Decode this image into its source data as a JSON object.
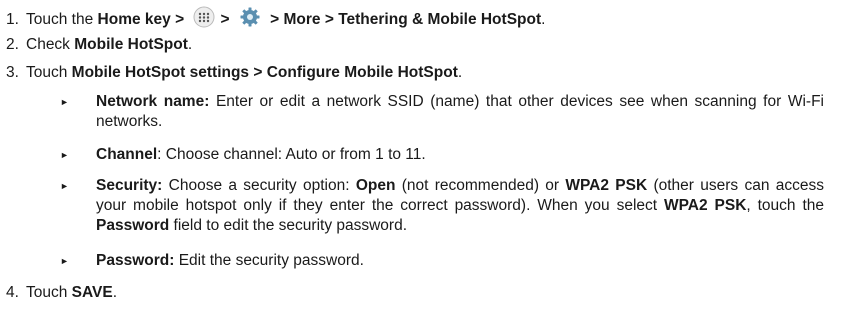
{
  "icons": {
    "apps": "apps-grid-icon",
    "settings": "settings-gear-icon"
  },
  "steps": [
    {
      "num": "1.",
      "pre": "Touch the ",
      "home": "Home",
      "key": " key ",
      "arrow": ">",
      "path": "> More > Tethering & Mobile HotSpot",
      "end": "."
    },
    {
      "num": "2.",
      "pre": "Check ",
      "bold": "Mobile HotSpot",
      "end": "."
    },
    {
      "num": "3.",
      "pre": "Touch ",
      "bold": "Mobile HotSpot settings > Configure Mobile HotSpot",
      "end": "."
    },
    {
      "num": "4.",
      "pre": "Touch ",
      "bold": "SAVE",
      "end": "."
    }
  ],
  "bullets": {
    "network": {
      "label": "Network name:",
      "text": " Enter or edit a network SSID (name) that other devices see when scanning for Wi-Fi networks."
    },
    "channel": {
      "label": "Channel",
      "text": ": Choose channel: Auto or from 1 to 11."
    },
    "security": {
      "label": "Security:",
      "t1": " Choose a security option: ",
      "open": "Open",
      "t2": " (not recommended) or ",
      "wpa": "WPA2 PSK",
      "t3": " (other users can access your mobile hotspot only if they enter the correct password). When you select ",
      "wpa2": "WPA2 PSK",
      "t4": ", touch the ",
      "pw": "Password",
      "t5": " field to edit the security password."
    },
    "password": {
      "label": "Password:",
      "text": " Edit the security password."
    }
  }
}
